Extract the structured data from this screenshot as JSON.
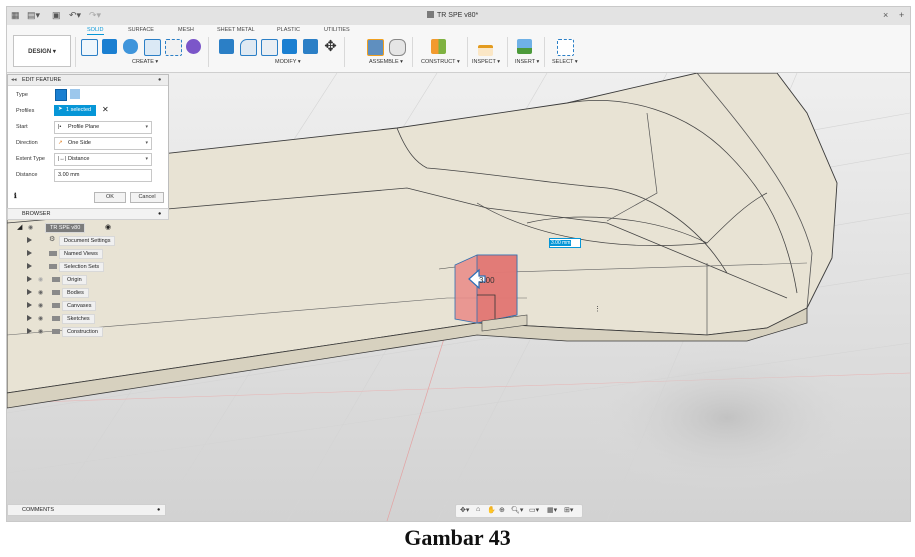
{
  "titlebar": {
    "doc_title": "TR SPE v80*",
    "close": "×",
    "new_tab": "+"
  },
  "ribbon": {
    "tabs": [
      "SOLID",
      "SURFACE",
      "MESH",
      "SHEET METAL",
      "PLASTIC",
      "UTILITIES"
    ],
    "design_label": "DESIGN ▾",
    "groups": [
      "CREATE ▾",
      "MODIFY ▾",
      "ASSEMBLE ▾",
      "CONSTRUCT ▾",
      "INSPECT ▾",
      "INSERT ▾",
      "SELECT ▾"
    ]
  },
  "edit_feature": {
    "title": "EDIT FEATURE",
    "type_label": "Type",
    "profiles_label": "Profiles",
    "profiles_value": "1 selected",
    "start_label": "Start",
    "start_value": "Profile Plane",
    "direction_label": "Direction",
    "direction_value": "One Side",
    "extent_label": "Extent Type",
    "extent_value": "Distance",
    "distance_label": "Distance",
    "distance_value": "3.00 mm",
    "ok": "OK",
    "cancel": "Cancel"
  },
  "browser": {
    "title": "BROWSER",
    "root": "TR SPE v80",
    "items": [
      "Document Settings",
      "Named Views",
      "Selection Sets",
      "Origin",
      "Bodies",
      "Canvases",
      "Sketches",
      "Construction"
    ]
  },
  "viewport": {
    "dimension_label": "3.00",
    "dimension_input": "3.00 mm"
  },
  "comments": {
    "title": "COMMENTS"
  },
  "caption": "Gambar 43"
}
